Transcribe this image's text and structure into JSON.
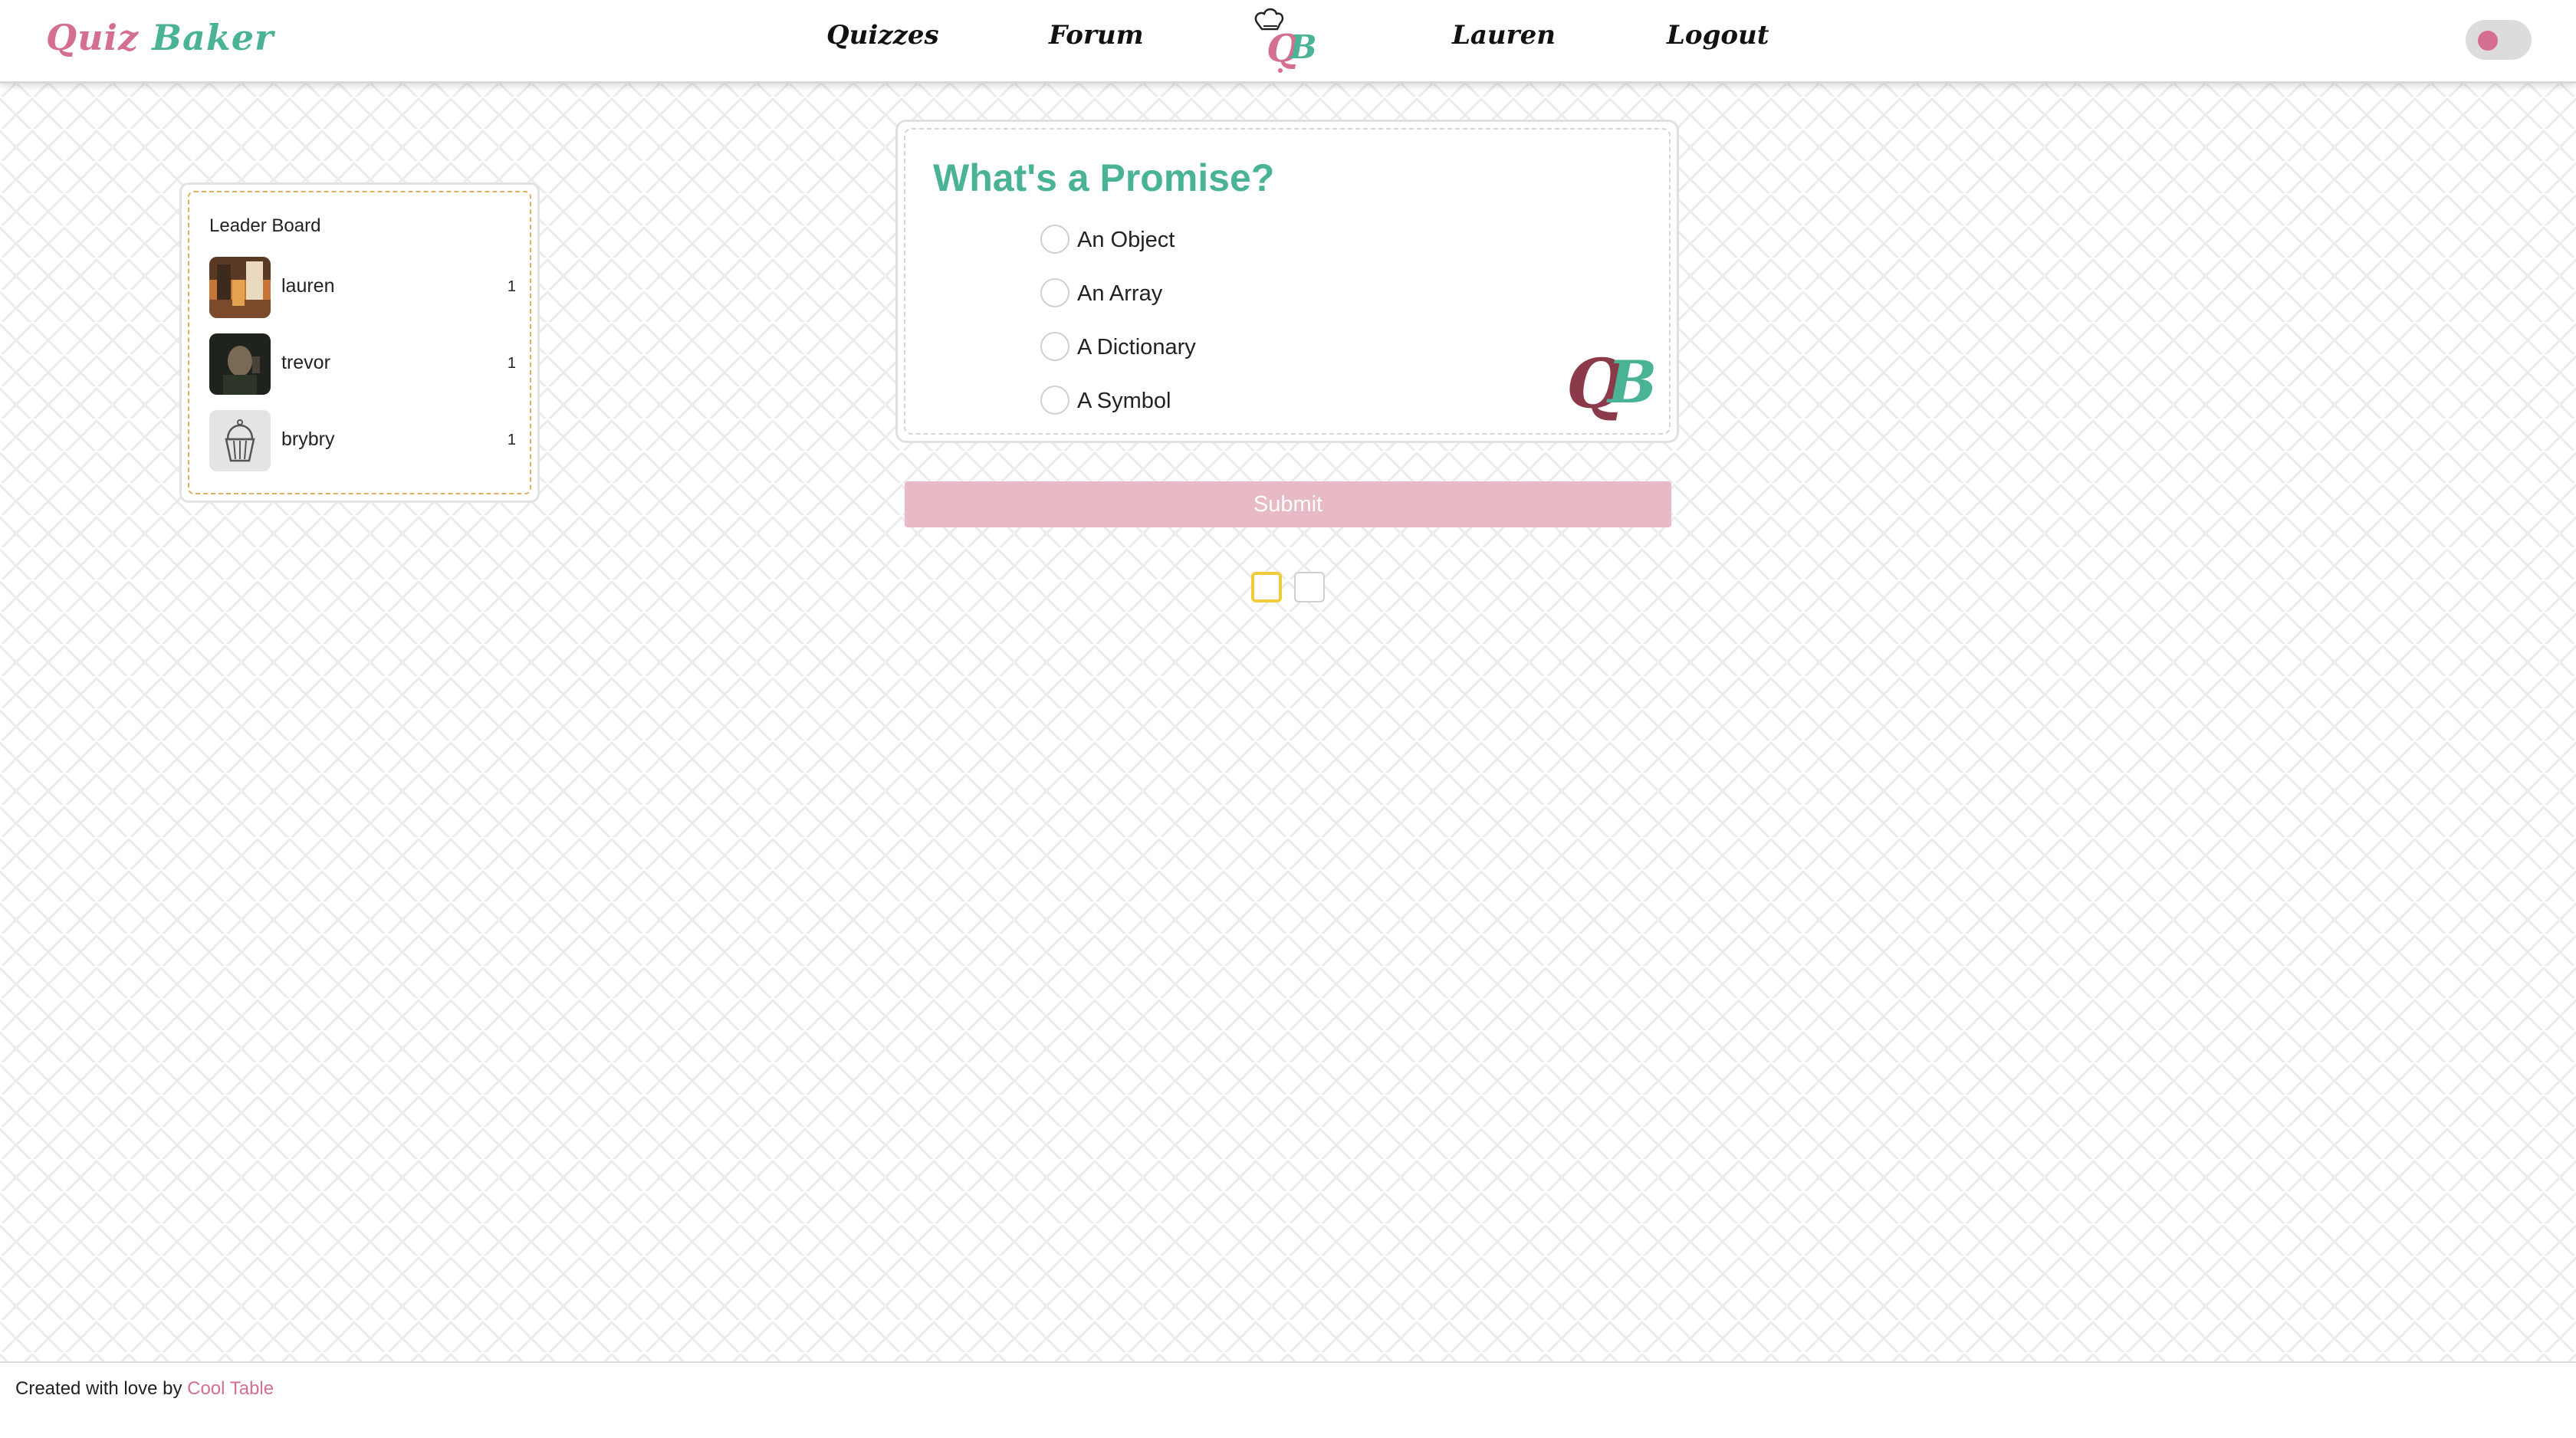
{
  "navbar": {
    "brand_first": "Quiz",
    "brand_second": "Baker",
    "links": [
      "Quizzes",
      "Forum",
      "Lauren",
      "Logout"
    ],
    "logo_text": "QB",
    "theme_toggle": {
      "on": false,
      "knob_color": "#d46f8f"
    }
  },
  "leaderboard": {
    "title": "Leader Board",
    "entries": [
      {
        "name": "lauren",
        "score": "1",
        "avatar": "photo"
      },
      {
        "name": "trevor",
        "score": "1",
        "avatar": "photo"
      },
      {
        "name": "brybry",
        "score": "1",
        "avatar": "cupcake-icon"
      }
    ]
  },
  "quiz": {
    "question": "What's a Promise?",
    "options": [
      "An Object",
      "An Array",
      "A Dictionary",
      "A Symbol"
    ],
    "logo_text": "QB",
    "submit_label": "Submit"
  },
  "pagination": {
    "pages": 2,
    "current": 1
  },
  "footer": {
    "text": "Created with love by",
    "link": "Cool Table"
  },
  "colors": {
    "brand_pink": "#d46f8f",
    "brand_green": "#4bb395",
    "submit_bg": "#e7bac6",
    "active_page": "#f2cb3a"
  }
}
